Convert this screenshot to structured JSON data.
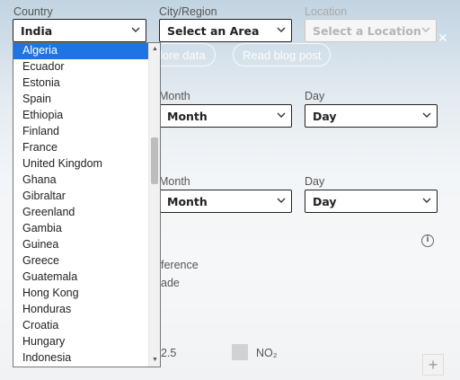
{
  "filters": {
    "country": {
      "label": "Country",
      "value": "India"
    },
    "city": {
      "label": "City/Region",
      "value": "Select an Area"
    },
    "location": {
      "label": "Location",
      "value": "Select a Location"
    }
  },
  "period1": {
    "month": {
      "label": "Month",
      "value": "Month"
    },
    "day": {
      "label": "Day",
      "value": "Day"
    }
  },
  "period2": {
    "month": {
      "label": "Month",
      "value": "Month"
    },
    "day": {
      "label": "Day",
      "value": "Day"
    }
  },
  "buttons": {
    "explore": "lore data",
    "blog": "Read blog post"
  },
  "fragments": {
    "ference": "ference",
    "ade": "ade",
    "pm": "2.5",
    "no2": "NO₂",
    "plus": "+"
  },
  "dropdown": {
    "selected_index": 0,
    "options": [
      "Algeria",
      "Ecuador",
      "Estonia",
      "Spain",
      "Ethiopia",
      "Finland",
      "France",
      "United Kingdom",
      "Ghana",
      "Gibraltar",
      "Greenland",
      "Gambia",
      "Guinea",
      "Greece",
      "Guatemala",
      "Hong Kong",
      "Honduras",
      "Croatia",
      "Hungary",
      "Indonesia"
    ]
  },
  "colors": {
    "selected_option": "#1e74e3",
    "select_border": "#222222"
  }
}
